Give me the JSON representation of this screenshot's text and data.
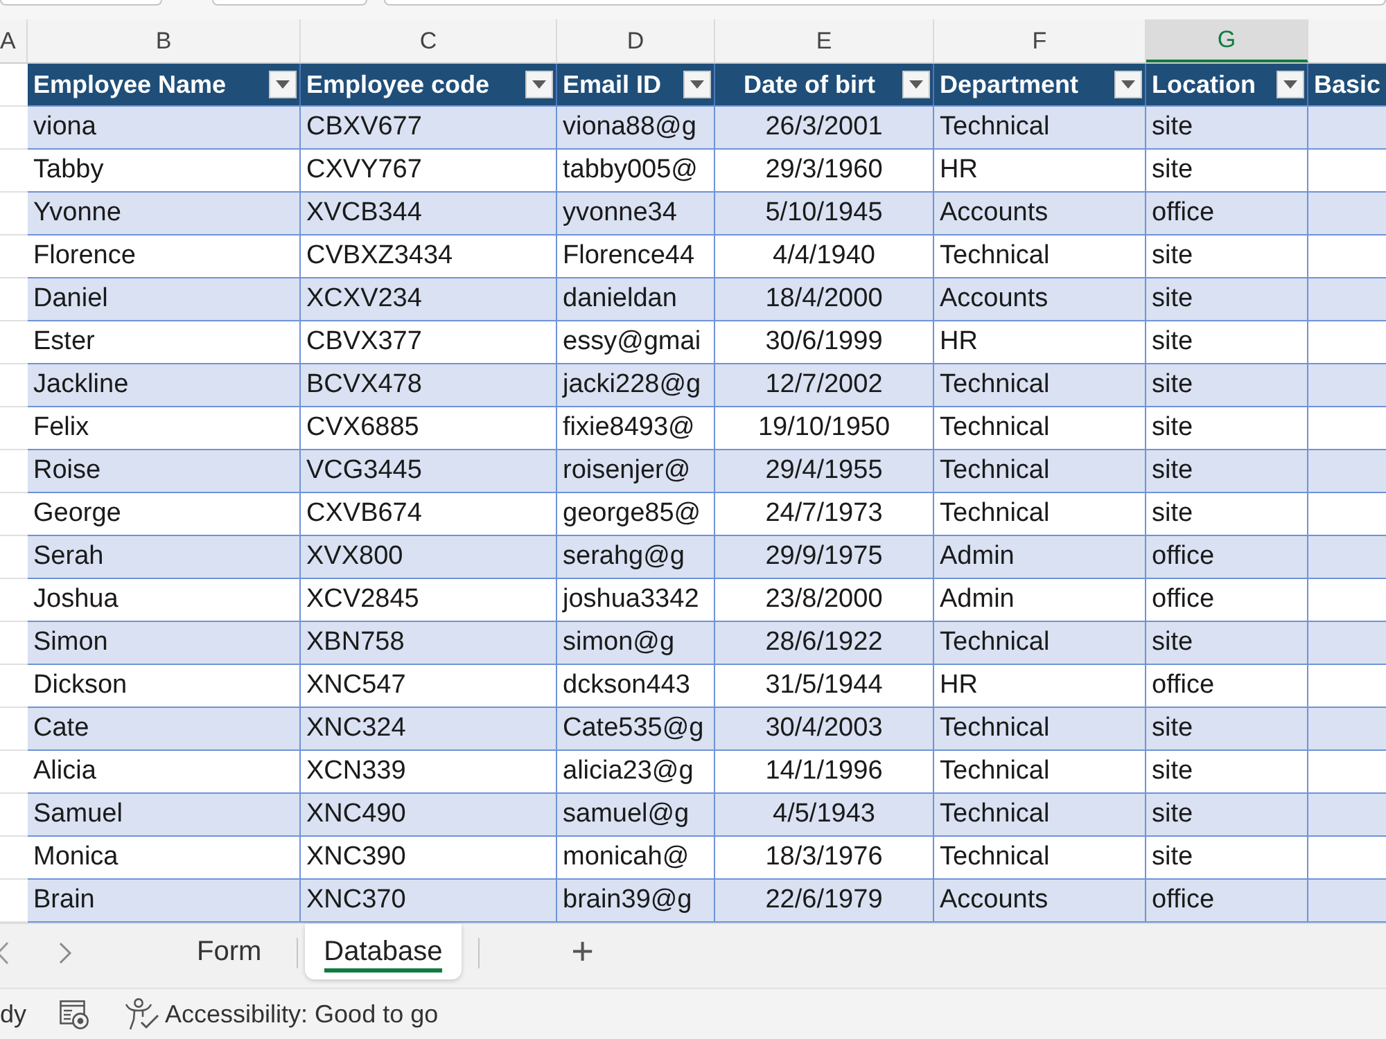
{
  "column_headers": [
    {
      "label": "A",
      "selected": false
    },
    {
      "label": "B",
      "selected": false
    },
    {
      "label": "C",
      "selected": false
    },
    {
      "label": "D",
      "selected": false
    },
    {
      "label": "E",
      "selected": false
    },
    {
      "label": "F",
      "selected": false
    },
    {
      "label": "G",
      "selected": true
    }
  ],
  "table": {
    "columns": [
      {
        "label": "Employee Name",
        "filter_button": true
      },
      {
        "label": "Employee code",
        "filter_button": true
      },
      {
        "label": "Email ID",
        "filter_button": true
      },
      {
        "label": "Date of birt",
        "filter_button": true
      },
      {
        "label": "Department",
        "filter_button": true
      },
      {
        "label": "Location",
        "filter_button": true
      },
      {
        "label": "Basic",
        "filter_button": false
      }
    ],
    "rows": [
      {
        "cells": [
          "viona",
          "CBXV677",
          "viona88@g",
          "26/3/2001",
          "Technical",
          "site"
        ]
      },
      {
        "cells": [
          "Tabby",
          "CXVY767",
          "tabby005@",
          "29/3/1960",
          "HR",
          "site"
        ]
      },
      {
        "cells": [
          "Yvonne",
          "XVCB344",
          "yvonne34",
          "5/10/1945",
          "Accounts",
          "office"
        ]
      },
      {
        "cells": [
          "Florence",
          "CVBXZ3434",
          "Florence44",
          "4/4/1940",
          "Technical",
          "site"
        ]
      },
      {
        "cells": [
          "Daniel",
          "XCXV234",
          "danieldan",
          "18/4/2000",
          "Accounts",
          "site"
        ]
      },
      {
        "cells": [
          "Ester",
          "CBVX377",
          "essy@gmai",
          "30/6/1999",
          "HR",
          "site"
        ]
      },
      {
        "cells": [
          "Jackline",
          "BCVX478",
          "jacki228@g",
          "12/7/2002",
          "Technical",
          "site"
        ]
      },
      {
        "cells": [
          "Felix",
          "CVX6885",
          "fixie8493@",
          "19/10/1950",
          "Technical",
          "site"
        ]
      },
      {
        "cells": [
          "Roise",
          "VCG3445",
          "roisenjer@",
          "29/4/1955",
          "Technical",
          "site"
        ]
      },
      {
        "cells": [
          "George",
          "CXVB674",
          "george85@",
          "24/7/1973",
          "Technical",
          "site"
        ]
      },
      {
        "cells": [
          "Serah",
          "XVX800",
          "serahg@g",
          "29/9/1975",
          "Admin",
          "office"
        ]
      },
      {
        "cells": [
          "Joshua",
          "XCV2845",
          "joshua3342",
          "23/8/2000",
          "Admin",
          "office"
        ]
      },
      {
        "cells": [
          "Simon",
          "XBN758",
          "simon@g",
          "28/6/1922",
          "Technical",
          "site"
        ]
      },
      {
        "cells": [
          "Dickson",
          "XNC547",
          "dckson443",
          "31/5/1944",
          "HR",
          "office"
        ]
      },
      {
        "cells": [
          "Cate",
          "XNC324",
          "Cate535@g",
          "30/4/2003",
          "Technical",
          "site"
        ]
      },
      {
        "cells": [
          "Alicia",
          "XCN339",
          "alicia23@g",
          "14/1/1996",
          "Technical",
          "site"
        ]
      },
      {
        "cells": [
          "Samuel",
          "XNC490",
          "samuel@g",
          "4/5/1943",
          "Technical",
          "site"
        ]
      },
      {
        "cells": [
          "Monica",
          "XNC390",
          "monicah@",
          "18/3/1976",
          "Technical",
          "site"
        ]
      },
      {
        "cells": [
          "Brain",
          "XNC370",
          "brain39@g",
          "22/6/1979",
          "Accounts",
          "office"
        ]
      }
    ]
  },
  "sheet_tabs": {
    "tabs": [
      {
        "label": "Form",
        "selected": false
      },
      {
        "label": "Database",
        "selected": true
      }
    ],
    "add_button": "+"
  },
  "status_bar": {
    "mode": "dy",
    "accessibility": "Accessibility: Good to go"
  }
}
